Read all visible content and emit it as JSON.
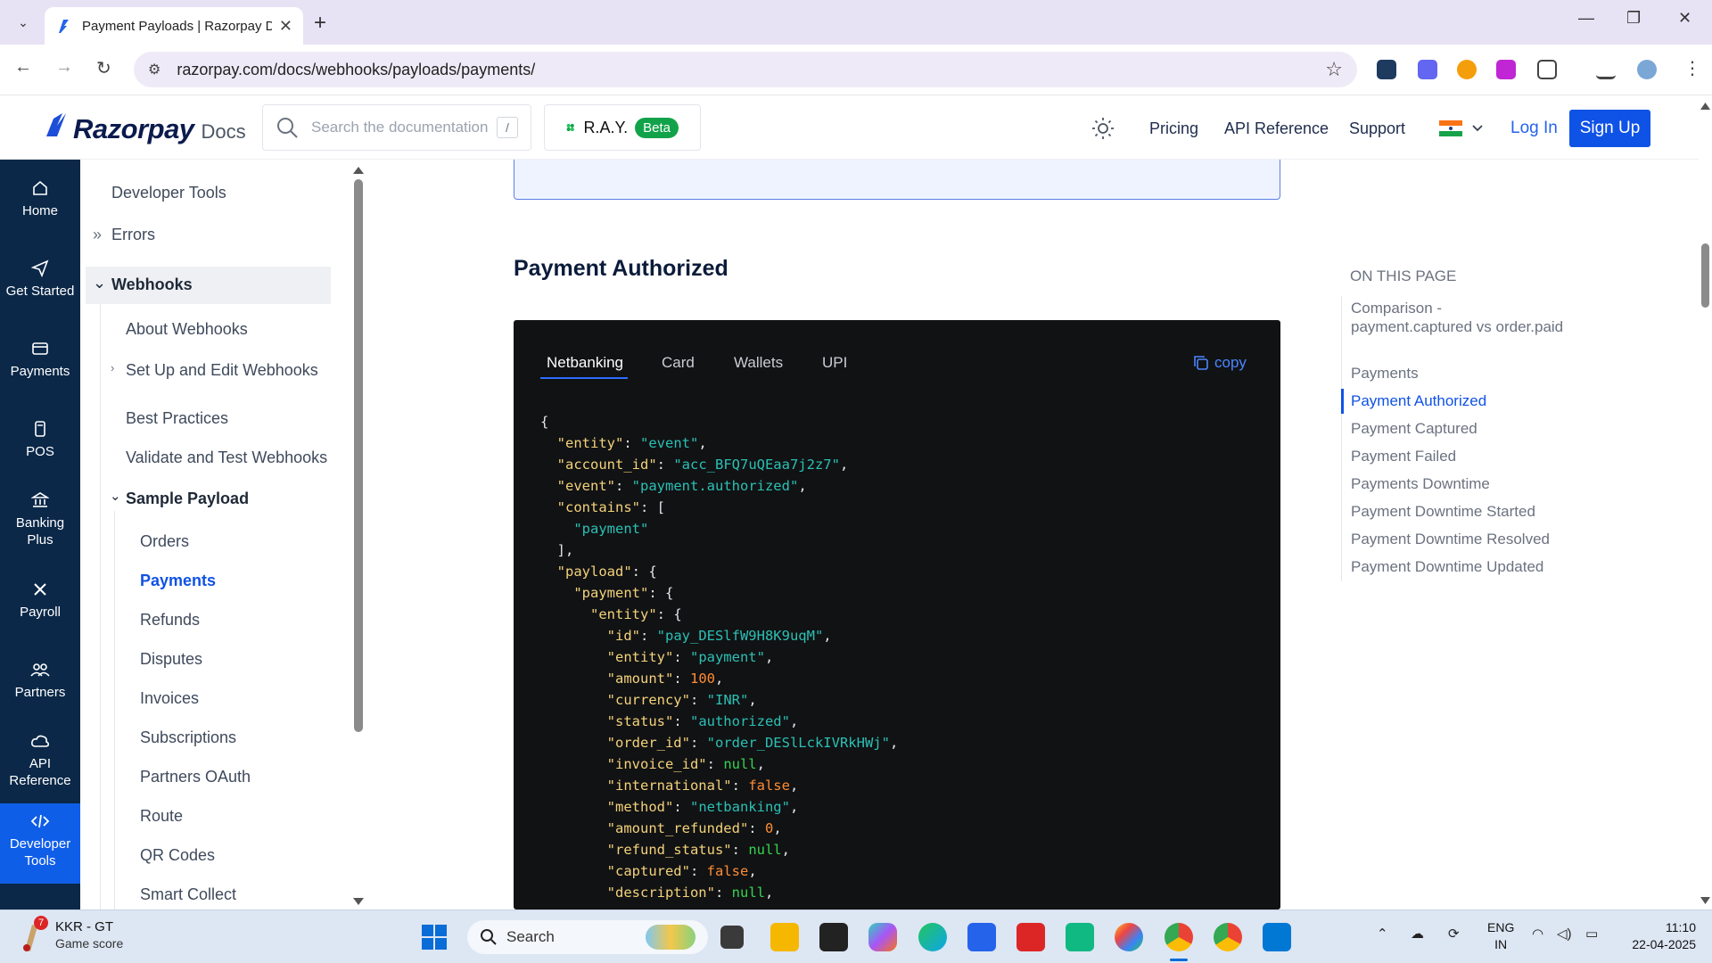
{
  "browser": {
    "tab_title": "Payment Payloads | Razorpay D",
    "url": "razorpay.com/docs/webhooks/payloads/payments/"
  },
  "header": {
    "logo_name": "Razorpay",
    "logo_docs": "Docs",
    "search_placeholder": "Search the documentation",
    "search_shortcut": "/",
    "ray_label": "R.A.Y.",
    "ray_badge": "Beta",
    "links": [
      "Pricing",
      "API Reference",
      "Support"
    ],
    "login": "Log In",
    "signup": "Sign Up"
  },
  "rail": [
    {
      "label": "Home",
      "icon": "home-icon"
    },
    {
      "label": "Get Started",
      "icon": "send-icon"
    },
    {
      "label": "Payments",
      "icon": "card-icon"
    },
    {
      "label": "POS",
      "icon": "pos-icon"
    },
    {
      "label": "Banking Plus",
      "icon": "bank-icon"
    },
    {
      "label": "Payroll",
      "icon": "payroll-icon"
    },
    {
      "label": "Partners",
      "icon": "partners-icon"
    },
    {
      "label": "API Reference",
      "icon": "cloud-icon"
    },
    {
      "label": "Developer Tools",
      "icon": "code-icon"
    }
  ],
  "sidenav": {
    "developer_tools": "Developer Tools",
    "errors": "Errors",
    "webhooks": "Webhooks",
    "about": "About Webhooks",
    "setup": "Set Up and Edit Webhooks",
    "best": "Best Practices",
    "validate": "Validate and Test Webhooks",
    "sample": "Sample Payload",
    "items": [
      "Orders",
      "Payments",
      "Refunds",
      "Disputes",
      "Invoices",
      "Subscriptions",
      "Partners OAuth",
      "Route",
      "QR Codes",
      "Smart Collect"
    ]
  },
  "content": {
    "heading": "Payment Authorized",
    "code_tabs": [
      "Netbanking",
      "Card",
      "Wallets",
      "UPI"
    ],
    "copy": "copy"
  },
  "on_this_page": {
    "title": "ON THIS PAGE",
    "items": [
      "Comparison - payment.captured vs order.paid",
      "Payments",
      "Payment Authorized",
      "Payment Captured",
      "Payment Failed",
      "Payments Downtime",
      "Payment Downtime Started",
      "Payment Downtime Resolved",
      "Payment Downtime Updated"
    ]
  },
  "taskbar": {
    "widget_title": "KKR - GT",
    "widget_sub": "Game score",
    "widget_badge": "7",
    "search": "Search",
    "lang1": "ENG",
    "lang2": "IN",
    "time": "11:10",
    "date": "22-04-2025"
  },
  "colors": {
    "brand_blue": "#0f52e6",
    "rail_bg": "#0b2848",
    "code_bg": "#111214"
  }
}
